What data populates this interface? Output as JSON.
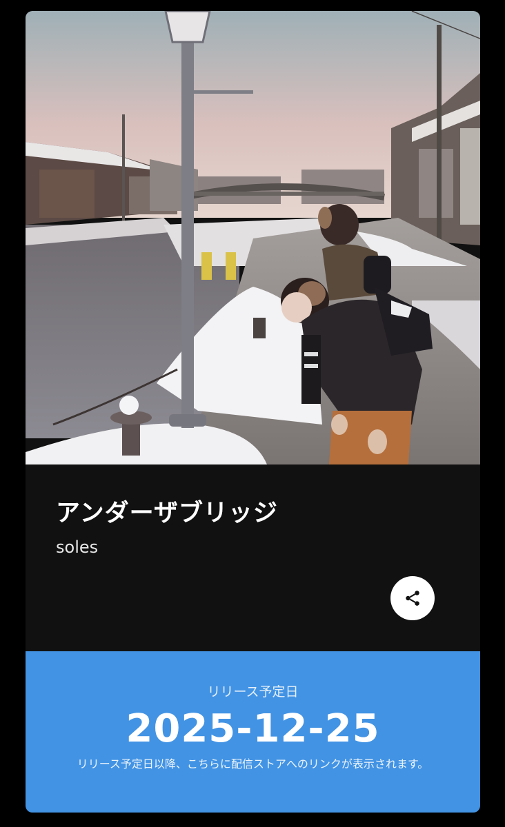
{
  "release": {
    "title": "アンダーザブリッジ",
    "artist": "soles",
    "date_label": "リリース予定日",
    "date": "2025-12-25",
    "note": "リリース予定日以降、こちらに配信ストアへのリンクが表示されます。"
  },
  "icons": {
    "share": "share-icon"
  },
  "colors": {
    "page_background": "#000000",
    "card_background": "#111111",
    "release_band": "#4293e4",
    "text_primary": "#ffffff"
  }
}
